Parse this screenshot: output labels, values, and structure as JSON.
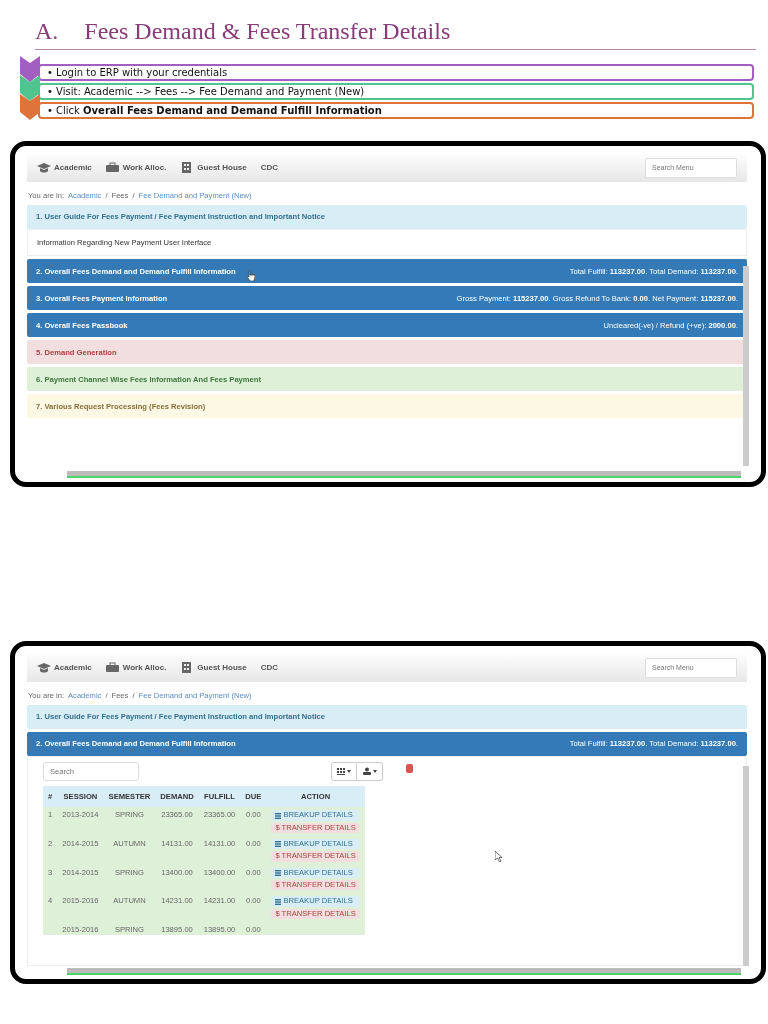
{
  "heading": {
    "letter": "A.",
    "title": "Fees Demand & Fees Transfer Details"
  },
  "steps": [
    {
      "color": "#a35fc0",
      "text": "• Login to ERP with your credentials"
    },
    {
      "color": "#4fc48e",
      "text": "• Visit: Academic --> Fees --> Fee Demand and Payment (New)"
    },
    {
      "color": "#e0733a",
      "text": "• Click **Overall Fees Demand and Demand Fulfill Information**"
    }
  ],
  "screenshots": [
    {
      "nav": [
        "Academic",
        "Work Alloc.",
        "Guest House",
        "CDC"
      ],
      "search": {
        "placeholder": "Search Menu"
      },
      "breadcrumb": {
        "prefix": "You are in:",
        "separator": "/",
        "items": [
          {
            "label": "Academic",
            "link": true
          },
          {
            "label": "Fees",
            "link": false
          },
          {
            "label": "Fee Demand and Payment (New)",
            "link": true
          }
        ]
      },
      "panels": [
        {
          "kind": "info",
          "title": "1. User Guide For Fees Payment / Fee Payment Instruction and Important Notice",
          "expanded": true,
          "body": "Information Regarding New Payment User Interface"
        },
        {
          "kind": "primary",
          "title": "2. Overall Fees Demand and Demand Fulfill Information",
          "expanded": false,
          "summary": "Total Fulfill: **113237.00**.   Total Demand: **113237.00**."
        },
        {
          "kind": "primary",
          "title": "3. Overall Fees Payment Information",
          "expanded": false,
          "summary": "Gross Payment: **115237.00**.   Gross Refund To Bank: **0.00**.   Net Payment: **115237.00**."
        },
        {
          "kind": "primary",
          "title": "4. Overall Fees Passbook",
          "expanded": false,
          "summary": "Uncleared(-ve) / Refund (+ve): **2000.00**."
        },
        {
          "kind": "danger",
          "title": "5. Demand Generation",
          "expanded": false
        },
        {
          "kind": "success",
          "title": "6. Payment Channel Wise Fees Information And Fees Payment",
          "expanded": false
        },
        {
          "kind": "warning",
          "title": "7. Various Request Processing (Fees Revision)",
          "expanded": false
        }
      ]
    },
    {
      "nav": [
        "Academic",
        "Work Alloc.",
        "Guest House",
        "CDC"
      ],
      "search": {
        "placeholder": "Search Menu"
      },
      "breadcrumb": {
        "prefix": "You are in:",
        "separator": "/",
        "items": [
          {
            "label": "Academic",
            "link": true
          },
          {
            "label": "Fees",
            "link": false
          },
          {
            "label": "Fee Demand and Payment (New)",
            "link": true
          }
        ]
      },
      "panels": [
        {
          "kind": "info",
          "title": "1. User Guide For Fees Payment / Fee Payment Instruction and Important Notice",
          "expanded": false
        },
        {
          "kind": "primary",
          "title": "2. Overall Fees Demand and Demand Fulfill Information",
          "expanded": true,
          "summary": "Total Fulfill: **113237.00**.   Total Demand: **113237.00**.",
          "table": {
            "search": {
              "placeholder": "Search"
            },
            "columns": [
              "#",
              "SESSION",
              "SEMESTER",
              "DEMAND",
              "FULFILL",
              "DUE",
              "ACTION"
            ],
            "rows": [
              {
                "cells": [
                  "1",
                  "2013-2014",
                  "SPRING",
                  "23365.00",
                  "23365.00",
                  "0.00"
                ],
                "actions": [
                  "BREAKUP DETAILS",
                  "$ TRANSFER DETAILS"
                ]
              },
              {
                "cells": [
                  "2",
                  "2014-2015",
                  "AUTUMN",
                  "14131.00",
                  "14131.00",
                  "0.00"
                ],
                "actions": [
                  "BREAKUP DETAILS",
                  "$ TRANSFER DETAILS"
                ]
              },
              {
                "cells": [
                  "3",
                  "2014-2015",
                  "SPRING",
                  "13400.00",
                  "13400.00",
                  "0.00"
                ],
                "actions": [
                  "BREAKUP DETAILS",
                  "$ TRANSFER DETAILS"
                ]
              },
              {
                "cells": [
                  "4",
                  "2015-2016",
                  "AUTUMN",
                  "14231.00",
                  "14231.00",
                  "0.00"
                ],
                "actions": [
                  "BREAKUP DETAILS",
                  "$ TRANSFER DETAILS"
                ]
              },
              {
                "cells": [
                  "",
                  "2015-2016",
                  "SPRING",
                  "13895.00",
                  "13895.00",
                  "0.00"
                ],
                "actions": []
              }
            ]
          }
        }
      ]
    }
  ]
}
